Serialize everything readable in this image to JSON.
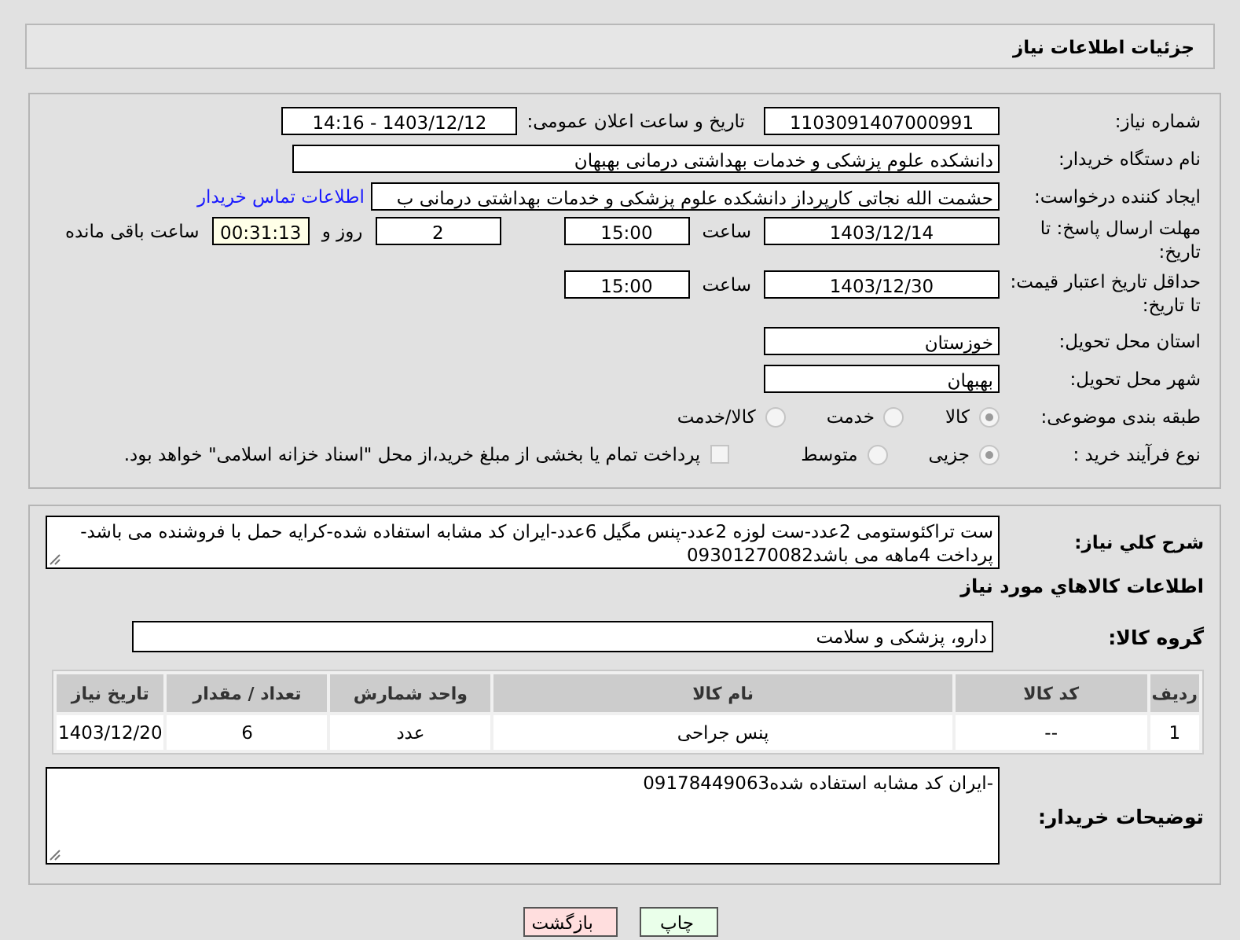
{
  "header": {
    "title": "جزئیات اطلاعات نیاز"
  },
  "need_number": {
    "label": "شماره نیاز:",
    "value": "1103091407000991"
  },
  "announce": {
    "label": "تاریخ و ساعت اعلان عمومی:",
    "value": "1403/12/12 - 14:16"
  },
  "buyer_org": {
    "label": "نام دستگاه خریدار:",
    "value": "دانشکده علوم پزشکی و خدمات بهداشتی  درمانی بهبهان"
  },
  "requester": {
    "label": "ایجاد کننده درخواست:",
    "value": "حشمت الله نجاتی کارپرداز دانشکده علوم پزشکی و خدمات بهداشتی  درمانی ب",
    "link": "اطلاعات تماس خریدار"
  },
  "deadline": {
    "label": "مهلت ارسال پاسخ: تا تاریخ:",
    "date": "1403/12/14",
    "time_label": "ساعت",
    "time": "15:00",
    "days": "2",
    "days_label": "روز و",
    "remaining": "00:31:13",
    "remaining_label": "ساعت باقی مانده"
  },
  "validity": {
    "label": "حداقل تاریخ اعتبار قیمت: تا تاریخ:",
    "date": "1403/12/30",
    "time_label": "ساعت",
    "time": "15:00"
  },
  "province": {
    "label": "استان محل تحویل:",
    "value": "خوزستان"
  },
  "city": {
    "label": "شهر محل تحویل:",
    "value": "بهبهان"
  },
  "category": {
    "label": "طبقه بندی موضوعی:",
    "options": [
      {
        "label": "کالا",
        "selected": true
      },
      {
        "label": "خدمت",
        "selected": false
      },
      {
        "label": "کالا/خدمت",
        "selected": false
      }
    ]
  },
  "process": {
    "label": "نوع فرآیند خرید :",
    "options": [
      {
        "label": "جزیی",
        "selected": true
      },
      {
        "label": "متوسط",
        "selected": false
      }
    ],
    "treasury": {
      "checked": false,
      "label": "پرداخت تمام یا بخشی از مبلغ خرید،از محل \"اسناد خزانه اسلامی\" خواهد بود."
    }
  },
  "description": {
    "label": "شرح کلي نياز:",
    "value": "ست تراکئوستومی 2عدد-ست لوزه 2عدد-پنس مگیل 6عدد-ایران کد مشابه استفاده شده-کرایه حمل با فروشنده می باشد-پرداخت 4ماهه می باشد09301270082"
  },
  "goods_heading": "اطلاعات كالاهاي مورد نياز",
  "goods_group": {
    "label": "گروه کالا:",
    "value": "دارو، پزشکی و سلامت"
  },
  "table": {
    "columns": [
      "ردیف",
      "کد کالا",
      "نام کالا",
      "واحد شمارش",
      "تعداد / مقدار",
      "تاریخ نیاز"
    ],
    "rows": [
      [
        "1",
        "--",
        "پنس جراحی",
        "عدد",
        "6",
        "1403/12/20"
      ]
    ]
  },
  "buyer_notes": {
    "label": "توضیحات خریدار:",
    "value": "-ایران کد مشابه استفاده شده09178449063"
  },
  "buttons": [
    {
      "label": "چاپ",
      "kind": "print"
    },
    {
      "label": "بازگشت",
      "kind": "back"
    }
  ]
}
